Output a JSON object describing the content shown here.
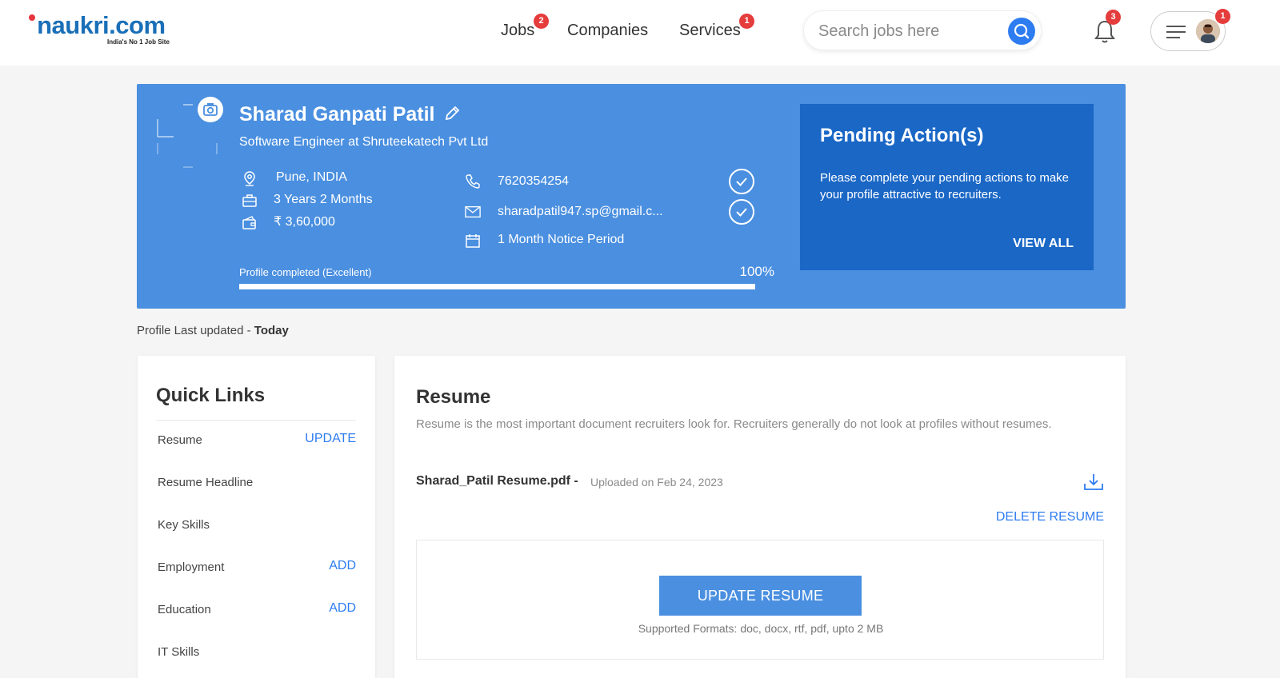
{
  "header": {
    "logo_word": "naukri",
    "logo_tld": ".com",
    "logo_tagline": "India's No 1 Job Site",
    "nav": [
      {
        "label": "Jobs",
        "badge": "2"
      },
      {
        "label": "Companies"
      },
      {
        "label": "Services",
        "badge": "1"
      }
    ],
    "search_placeholder": "Search jobs here",
    "notification_badge": "3",
    "menu_badge": "1"
  },
  "profile": {
    "name": "Sharad Ganpati Patil",
    "headline": "Software Engineer at Shruteekatech Pvt Ltd",
    "location": "Pune, INDIA",
    "experience": "3 Years 2 Months",
    "salary": "₹ 3,60,000",
    "phone": "7620354254",
    "email": "sharadpatil947.sp@gmail.c...",
    "notice_period": "1 Month Notice Period",
    "progress_label": "Profile completed (Excellent)",
    "progress_text": "100%",
    "progress_fraction": 1.0
  },
  "pending": {
    "title": "Pending Action(s)",
    "text": "Please complete your pending actions to make your profile attractive to recruiters.",
    "link": "VIEW ALL"
  },
  "last_updated": {
    "prefix": "Profile Last updated - ",
    "value": "Today"
  },
  "quick_links": {
    "title": "Quick Links",
    "items": [
      {
        "label": "Resume",
        "action": "UPDATE"
      },
      {
        "label": "Resume Headline",
        "action": ""
      },
      {
        "label": "Key Skills",
        "action": ""
      },
      {
        "label": "Employment",
        "action": "ADD"
      },
      {
        "label": "Education",
        "action": "ADD"
      },
      {
        "label": "IT Skills",
        "action": ""
      }
    ]
  },
  "resume": {
    "title": "Resume",
    "description": "Resume is the most important document recruiters look for. Recruiters generally do not look at profiles without resumes.",
    "file_name": "Sharad_Patil Resume.pdf -",
    "uploaded": "Uploaded on Feb 24, 2023",
    "delete_label": "DELETE RESUME",
    "update_button": "UPDATE RESUME",
    "formats": "Supported Formats: doc, docx, rtf, pdf, upto 2 MB"
  },
  "colors": {
    "brand_blue": "#4a8fe0",
    "pending_blue": "#1a67c6",
    "link_blue": "#2d7cf0",
    "badge_red": "#e53c3c"
  }
}
